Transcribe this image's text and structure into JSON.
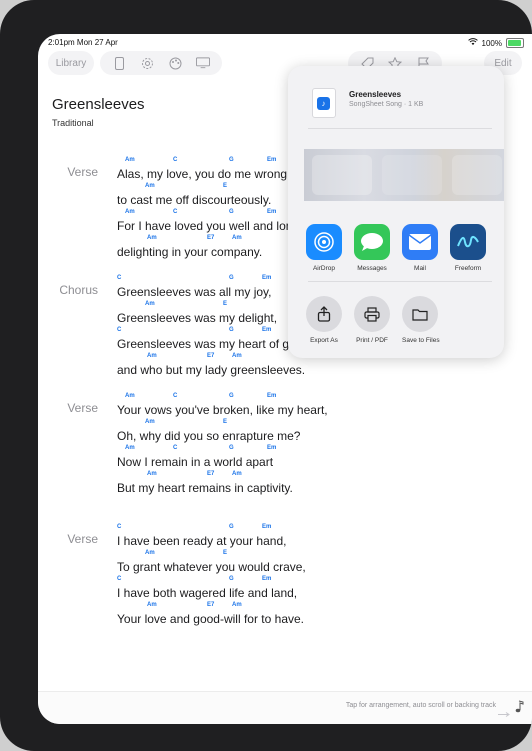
{
  "status": {
    "time": "2:01pm  Mon 27 Apr",
    "battery": "100%"
  },
  "toolbar": {
    "library": "Library",
    "edit": "Edit"
  },
  "song": {
    "title": "Greensleeves",
    "artist": "Traditional",
    "sections": [
      {
        "label": "Verse",
        "lines": [
          {
            "chords": [
              "Am",
              "C",
              "G",
              "Em"
            ],
            "lyric": "Alas, my love, you do me wrong"
          },
          {
            "chords": [
              "Am",
              "E"
            ],
            "lyric": "to cast me off discourteously."
          },
          {
            "chords": [
              "Am",
              "C",
              "G",
              "Em"
            ],
            "lyric": "For I have loved you well and long,"
          },
          {
            "chords": [
              "Am",
              "E7",
              "Am"
            ],
            "lyric": "delighting in your company."
          }
        ]
      },
      {
        "label": "Chorus",
        "lines": [
          {
            "chords": [
              "C",
              "G",
              "Em"
            ],
            "lyric": "Greensleeves was all my joy,"
          },
          {
            "chords": [
              "Am",
              "E"
            ],
            "lyric": "Greensleeves was my delight,"
          },
          {
            "chords": [
              "C",
              "G",
              "Em"
            ],
            "lyric": "Greensleeves was my heart of gold,"
          },
          {
            "chords": [
              "Am",
              "E7",
              "Am"
            ],
            "lyric": "and who but my lady greensleeves."
          }
        ]
      },
      {
        "label": "Verse",
        "lines": [
          {
            "chords": [
              "Am",
              "C",
              "G",
              "Em"
            ],
            "lyric": "Your vows you've broken, like my heart,"
          },
          {
            "chords": [
              "Am",
              "E"
            ],
            "lyric": "Oh, why did you so enrapture me?"
          },
          {
            "chords": [
              "Am",
              "C",
              "G",
              "Em"
            ],
            "lyric": "Now I remain in a world apart"
          },
          {
            "chords": [
              "Am",
              "E7",
              "Am"
            ],
            "lyric": "But my heart remains in captivity."
          }
        ]
      },
      {
        "label": "Verse",
        "lines": [
          {
            "chords": [
              "C",
              "G",
              "Em"
            ],
            "lyric": "I have been ready at your hand,"
          },
          {
            "chords": [
              "Am",
              "E"
            ],
            "lyric": "To grant whatever you would crave,"
          },
          {
            "chords": [
              "C",
              "G",
              "Em"
            ],
            "lyric": "I have both wagered life and land,"
          },
          {
            "chords": [
              "Am",
              "E7",
              "Am"
            ],
            "lyric": "Your love and good-will for to have."
          }
        ]
      }
    ]
  },
  "bottom": {
    "hint": "Tap for arrangement, auto scroll or backing track"
  },
  "share": {
    "doc_title": "Greensleeves",
    "doc_sub": "SongSheet Song · 1 KB",
    "apps": [
      {
        "label": "AirDrop",
        "icon": "airdrop-icon",
        "color": "#1a8cff"
      },
      {
        "label": "Messages",
        "icon": "messages-icon",
        "color": "#34c759"
      },
      {
        "label": "Mail",
        "icon": "mail-icon",
        "color": "#2f7df6"
      },
      {
        "label": "Freeform",
        "icon": "freeform-icon",
        "color": "#1b4f8c"
      }
    ],
    "actions": [
      {
        "label": "Export As",
        "icon": "export-icon"
      },
      {
        "label": "Print / PDF",
        "icon": "printer-icon"
      },
      {
        "label": "Save to Files",
        "icon": "folder-icon"
      }
    ]
  },
  "colors": {
    "chord": "#1a73e8",
    "accent": "#1a73e8"
  }
}
